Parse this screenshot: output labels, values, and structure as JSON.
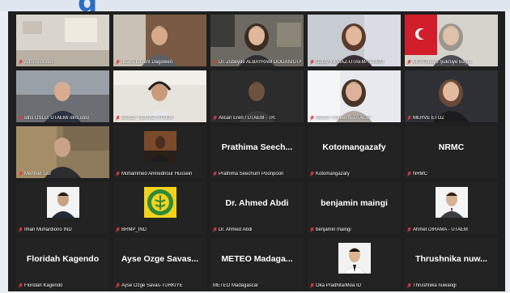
{
  "header_char": "g",
  "tiles": [
    {
      "name": "Administrator",
      "type": "video",
      "scene": "office"
    },
    {
      "name": "İlhami Levent Dagdelen",
      "type": "video",
      "scene": "man-brick"
    },
    {
      "name": "Dr. Zübeyde ALBAYRAM DOĞAN/UTAE...",
      "type": "video",
      "scene": "woman-office",
      "active": true
    },
    {
      "name": "Gülay YILMAZ-UTAEM/TAGEM",
      "type": "video",
      "scene": "woman-glasses"
    },
    {
      "name": "MFATürkiye Şükrüye Bayat",
      "type": "video",
      "scene": "woman-flag"
    },
    {
      "name": "İdris USLU/ UTAEM/ idris.uslu",
      "type": "video",
      "scene": "man-glasses"
    },
    {
      "name": "Serdar YILMAZ-UTAEM",
      "type": "video",
      "scene": "man-headset"
    },
    {
      "name": "Alican Eren / UTAEM - TR.",
      "type": "video",
      "scene": "man-dark"
    },
    {
      "name": "Gözen Yüceerim-UTAEM",
      "type": "video",
      "scene": "woman-light"
    },
    {
      "name": "MERVE ETÖZ",
      "type": "video",
      "scene": "woman-dark"
    },
    {
      "name": "Mehmet Gür",
      "type": "video",
      "scene": "man-bald"
    },
    {
      "name": "Mohammed Ahmednour Hussein",
      "type": "photo",
      "scene": "man-thumb"
    },
    {
      "name": "Prathima Seechurn Poonpoon",
      "type": "text",
      "display": "Prathima  Seech..."
    },
    {
      "name": "Kotomangazafy",
      "type": "text",
      "display": "Kotomangazafy"
    },
    {
      "name": "NRMC",
      "type": "text",
      "display": "NRMC"
    },
    {
      "name": "Iman Muhardiono IND",
      "type": "photo",
      "scene": "man-thumb-dark"
    },
    {
      "name": "BRMP_IND",
      "type": "photo",
      "scene": "logo"
    },
    {
      "name": "Dr. Ahmed Abdi",
      "type": "text",
      "display": "Dr. Ahmed Abdi"
    },
    {
      "name": "benjamin maingi",
      "type": "text",
      "display": "benjamin maingi"
    },
    {
      "name": "Ahmet DIRAMA - UTAEM",
      "type": "photo",
      "scene": "man-thumb-suit"
    },
    {
      "name": "Floridah Kagendo",
      "type": "text",
      "display": "Floridah Kagendo"
    },
    {
      "name": "Ayse Ozge Savas-TURKIYE",
      "type": "text",
      "display": "Ayse Ozge Savas..."
    },
    {
      "name": "METEO Madagascar",
      "type": "text",
      "display": "METEO  Madaga...",
      "nomic": true
    },
    {
      "name": "Oka Pradhita/Moa ID",
      "type": "photo",
      "scene": "man-thumb-light"
    },
    {
      "name": "Thrushnika nuwangi",
      "type": "text",
      "display": "Thrushnika  nuw..."
    }
  ]
}
